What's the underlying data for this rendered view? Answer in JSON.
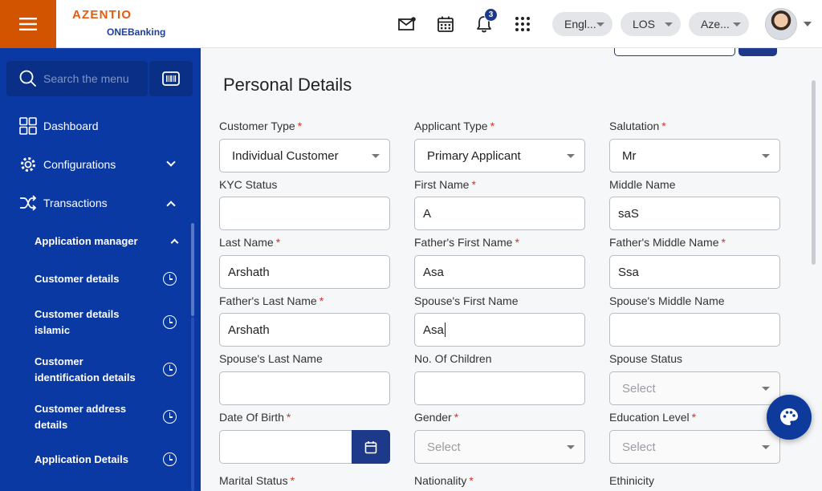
{
  "header": {
    "brand": "AZENTIO",
    "product_prefix": "ONE",
    "product_suffix": "Banking",
    "notification_count": "3",
    "language_pill": "Engl...",
    "module_pill": "LOS",
    "entity_pill": "Aze...",
    "icons": [
      "menu-icon",
      "mail-icon",
      "calendar-icon",
      "bell-icon",
      "apps-grid-icon"
    ]
  },
  "sidebar": {
    "search_placeholder": "Search the menu",
    "items": [
      {
        "label": "Dashboard"
      },
      {
        "label": "Configurations"
      },
      {
        "label": "Transactions"
      }
    ],
    "sub_items": [
      {
        "label": "Application manager"
      },
      {
        "label": "Customer details"
      },
      {
        "label": "Customer details islamic"
      },
      {
        "label": "Customer identification details"
      },
      {
        "label": "Customer address details"
      },
      {
        "label": "Application Details"
      }
    ]
  },
  "form": {
    "title": "Personal Details",
    "required_mark": "*",
    "fields": {
      "customer_type": {
        "label": "Customer Type",
        "value": "Individual Customer"
      },
      "applicant_type": {
        "label": "Applicant Type",
        "value": "Primary Applicant"
      },
      "salutation": {
        "label": "Salutation",
        "value": "Mr"
      },
      "kyc_status": {
        "label": "KYC Status",
        "value": ""
      },
      "first_name": {
        "label": "First Name",
        "value": "A"
      },
      "middle_name": {
        "label": "Middle Name",
        "value": "saS"
      },
      "last_name": {
        "label": "Last Name",
        "value": "Arshath"
      },
      "father_first_name": {
        "label": "Father's First Name",
        "value": "Asa"
      },
      "father_middle_name": {
        "label": "Father's Middle Name",
        "value": "Ssa"
      },
      "father_last_name": {
        "label": "Father's Last Name",
        "value": "Arshath"
      },
      "spouse_first_name": {
        "label": "Spouse's First Name",
        "value": "Asa"
      },
      "spouse_middle_name": {
        "label": "Spouse's Middle Name",
        "value": ""
      },
      "spouse_last_name": {
        "label": "Spouse's Last Name",
        "value": ""
      },
      "no_of_children": {
        "label": "No. Of Children",
        "value": ""
      },
      "spouse_status": {
        "label": "Spouse Status",
        "placeholder": "Select"
      },
      "date_of_birth": {
        "label": "Date Of Birth",
        "value": ""
      },
      "gender": {
        "label": "Gender",
        "placeholder": "Select"
      },
      "education_level": {
        "label": "Education Level",
        "placeholder": "Select"
      },
      "marital_status": {
        "label": "Marital Status"
      },
      "nationality": {
        "label": "Nationality"
      },
      "ethnicity": {
        "label": "Ethinicity"
      }
    }
  },
  "colors": {
    "sidebar_bg": "#0b39a4",
    "accent": "#1d3a8a",
    "brand_orange": "#e8590c",
    "required": "#d0342c"
  }
}
